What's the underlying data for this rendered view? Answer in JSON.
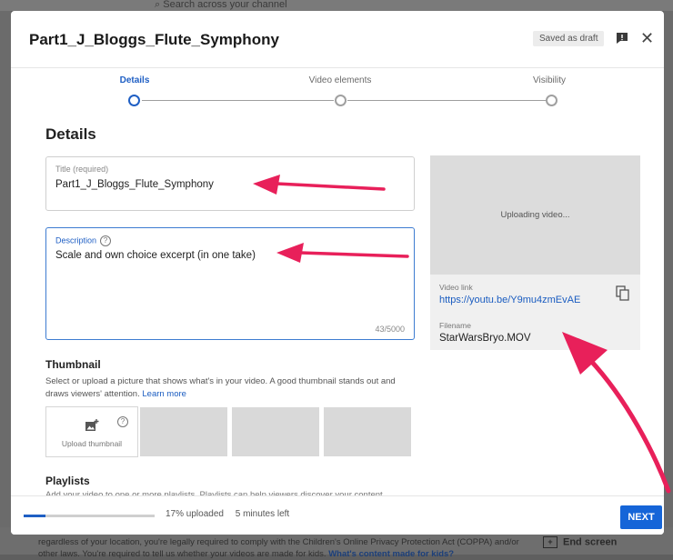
{
  "background": {
    "search_placeholder": "Search across your channel",
    "bottom_notice": "regardless of your location, you're legally required to comply with the Children's Online Privacy Protection Act (COPPA) and/or other laws. You're required to tell us whether your videos are made for kids.",
    "bottom_link": "What's content made for kids?",
    "end_screen_label": "End screen"
  },
  "dialog": {
    "title": "Part1_J_Bloggs_Flute_Symphony",
    "saved_badge": "Saved as draft",
    "icons": {
      "feedback": "feedback-icon",
      "close": "close-icon"
    }
  },
  "stepper": {
    "steps": [
      {
        "label": "Details",
        "active": true
      },
      {
        "label": "Video elements",
        "active": false
      },
      {
        "label": "Visibility",
        "active": false
      }
    ]
  },
  "details": {
    "heading": "Details",
    "title_field": {
      "label": "Title (required)",
      "value": "Part1_J_Bloggs_Flute_Symphony"
    },
    "description_field": {
      "label": "Description",
      "value": "Scale and own choice excerpt (in one take)",
      "char_count": "43/5000"
    }
  },
  "preview": {
    "status": "Uploading video...",
    "video_link_label": "Video link",
    "video_link": "https://youtu.be/Y9mu4zmEvAE",
    "filename_label": "Filename",
    "filename": "StarWarsBryo.MOV"
  },
  "thumbnail": {
    "heading": "Thumbnail",
    "description": "Select or upload a picture that shows what's in your video. A good thumbnail stands out and draws viewers' attention.",
    "learn_more": "Learn more",
    "upload_label": "Upload thumbnail"
  },
  "playlists": {
    "heading": "Playlists",
    "description": "Add your video to one or more playlists. Playlists can help viewers discover your content"
  },
  "footer": {
    "progress_percent": 17,
    "uploaded_text": "17% uploaded",
    "time_left": "5 minutes left",
    "next_label": "NEXT"
  },
  "colors": {
    "accent": "#1f5fc4",
    "annotation_arrow": "#e8205a"
  }
}
